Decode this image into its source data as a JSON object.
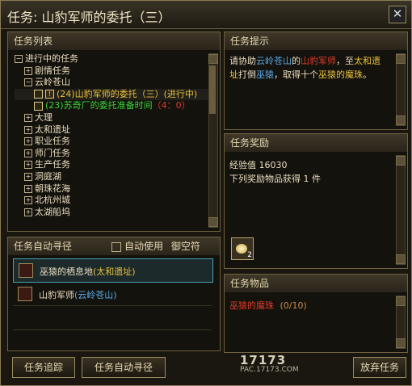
{
  "window": {
    "title": "任务: 山豹军师的委托（三）",
    "close_glyph": "✕"
  },
  "quest_list": {
    "header": "任务列表",
    "items": [
      {
        "toggle": "−",
        "text": "进行中的任务",
        "color": "normal",
        "indent": 0
      },
      {
        "toggle": "+",
        "text": "剧情任务",
        "color": "normal",
        "indent": 1
      },
      {
        "toggle": "−",
        "text": "云岭苍山",
        "color": "normal",
        "indent": 1
      },
      {
        "quest": true,
        "text": "(24)山豹军师的委托（三）(进行中)",
        "color": "yellow",
        "indent": 2,
        "selected": true
      },
      {
        "quest": true,
        "text": "(23)苏奇厂的委托准备时间",
        "extra": "（4：0）",
        "color": "green",
        "indent": 2
      },
      {
        "toggle": "+",
        "text": "大理",
        "color": "normal",
        "indent": 1
      },
      {
        "toggle": "+",
        "text": "太和遗址",
        "color": "normal",
        "indent": 1
      },
      {
        "toggle": "+",
        "text": "职业任务",
        "color": "normal",
        "indent": 1
      },
      {
        "toggle": "+",
        "text": "师门任务",
        "color": "normal",
        "indent": 1
      },
      {
        "toggle": "+",
        "text": "生产任务",
        "color": "normal",
        "indent": 1
      },
      {
        "toggle": "+",
        "text": "洞庭湖",
        "color": "normal",
        "indent": 1
      },
      {
        "toggle": "+",
        "text": "朝珠花海",
        "color": "normal",
        "indent": 1
      },
      {
        "toggle": "+",
        "text": "北杭州城",
        "color": "normal",
        "indent": 1
      },
      {
        "toggle": "+",
        "text": "太湖船坞",
        "color": "normal",
        "indent": 1
      }
    ]
  },
  "auto_path": {
    "header": "任务自动寻径",
    "checkbox_label": "自动使用",
    "checkbox_label2": "御空符",
    "rows": [
      {
        "name": "巫猿的栖息地",
        "loc": "(太和遗址)"
      },
      {
        "name": "山豹军师",
        "loc": "(云岭苍山)"
      }
    ]
  },
  "hint": {
    "header": "任务提示",
    "text_parts": [
      {
        "t": "请协助",
        "c": "normal"
      },
      {
        "t": "云岭苍山",
        "c": "blue"
      },
      {
        "t": "的",
        "c": "normal"
      },
      {
        "t": "山豹军师",
        "c": "red"
      },
      {
        "t": "，至",
        "c": "normal"
      },
      {
        "t": "太和遗址",
        "c": "yellow"
      },
      {
        "t": "打倒",
        "c": "normal"
      },
      {
        "t": "巫猿",
        "c": "blue"
      },
      {
        "t": "，取得十个",
        "c": "normal"
      },
      {
        "t": "巫猿的魔珠",
        "c": "yellow"
      },
      {
        "t": "。",
        "c": "normal"
      }
    ]
  },
  "reward": {
    "header": "任务奖励",
    "exp_label": "经验值",
    "exp_value": "16030",
    "items_line": "下列奖励物品获得 1 件",
    "item_count": "2"
  },
  "items_panel": {
    "header": "任务物品",
    "entry": "巫猿的魔珠",
    "progress": "(0/10)"
  },
  "buttons": {
    "track": "任务追踪",
    "auto_path": "任务自动寻径",
    "abandon": "放弃任务"
  },
  "watermark": {
    "text": "17173",
    "sub": "PAC.17173.COM"
  }
}
